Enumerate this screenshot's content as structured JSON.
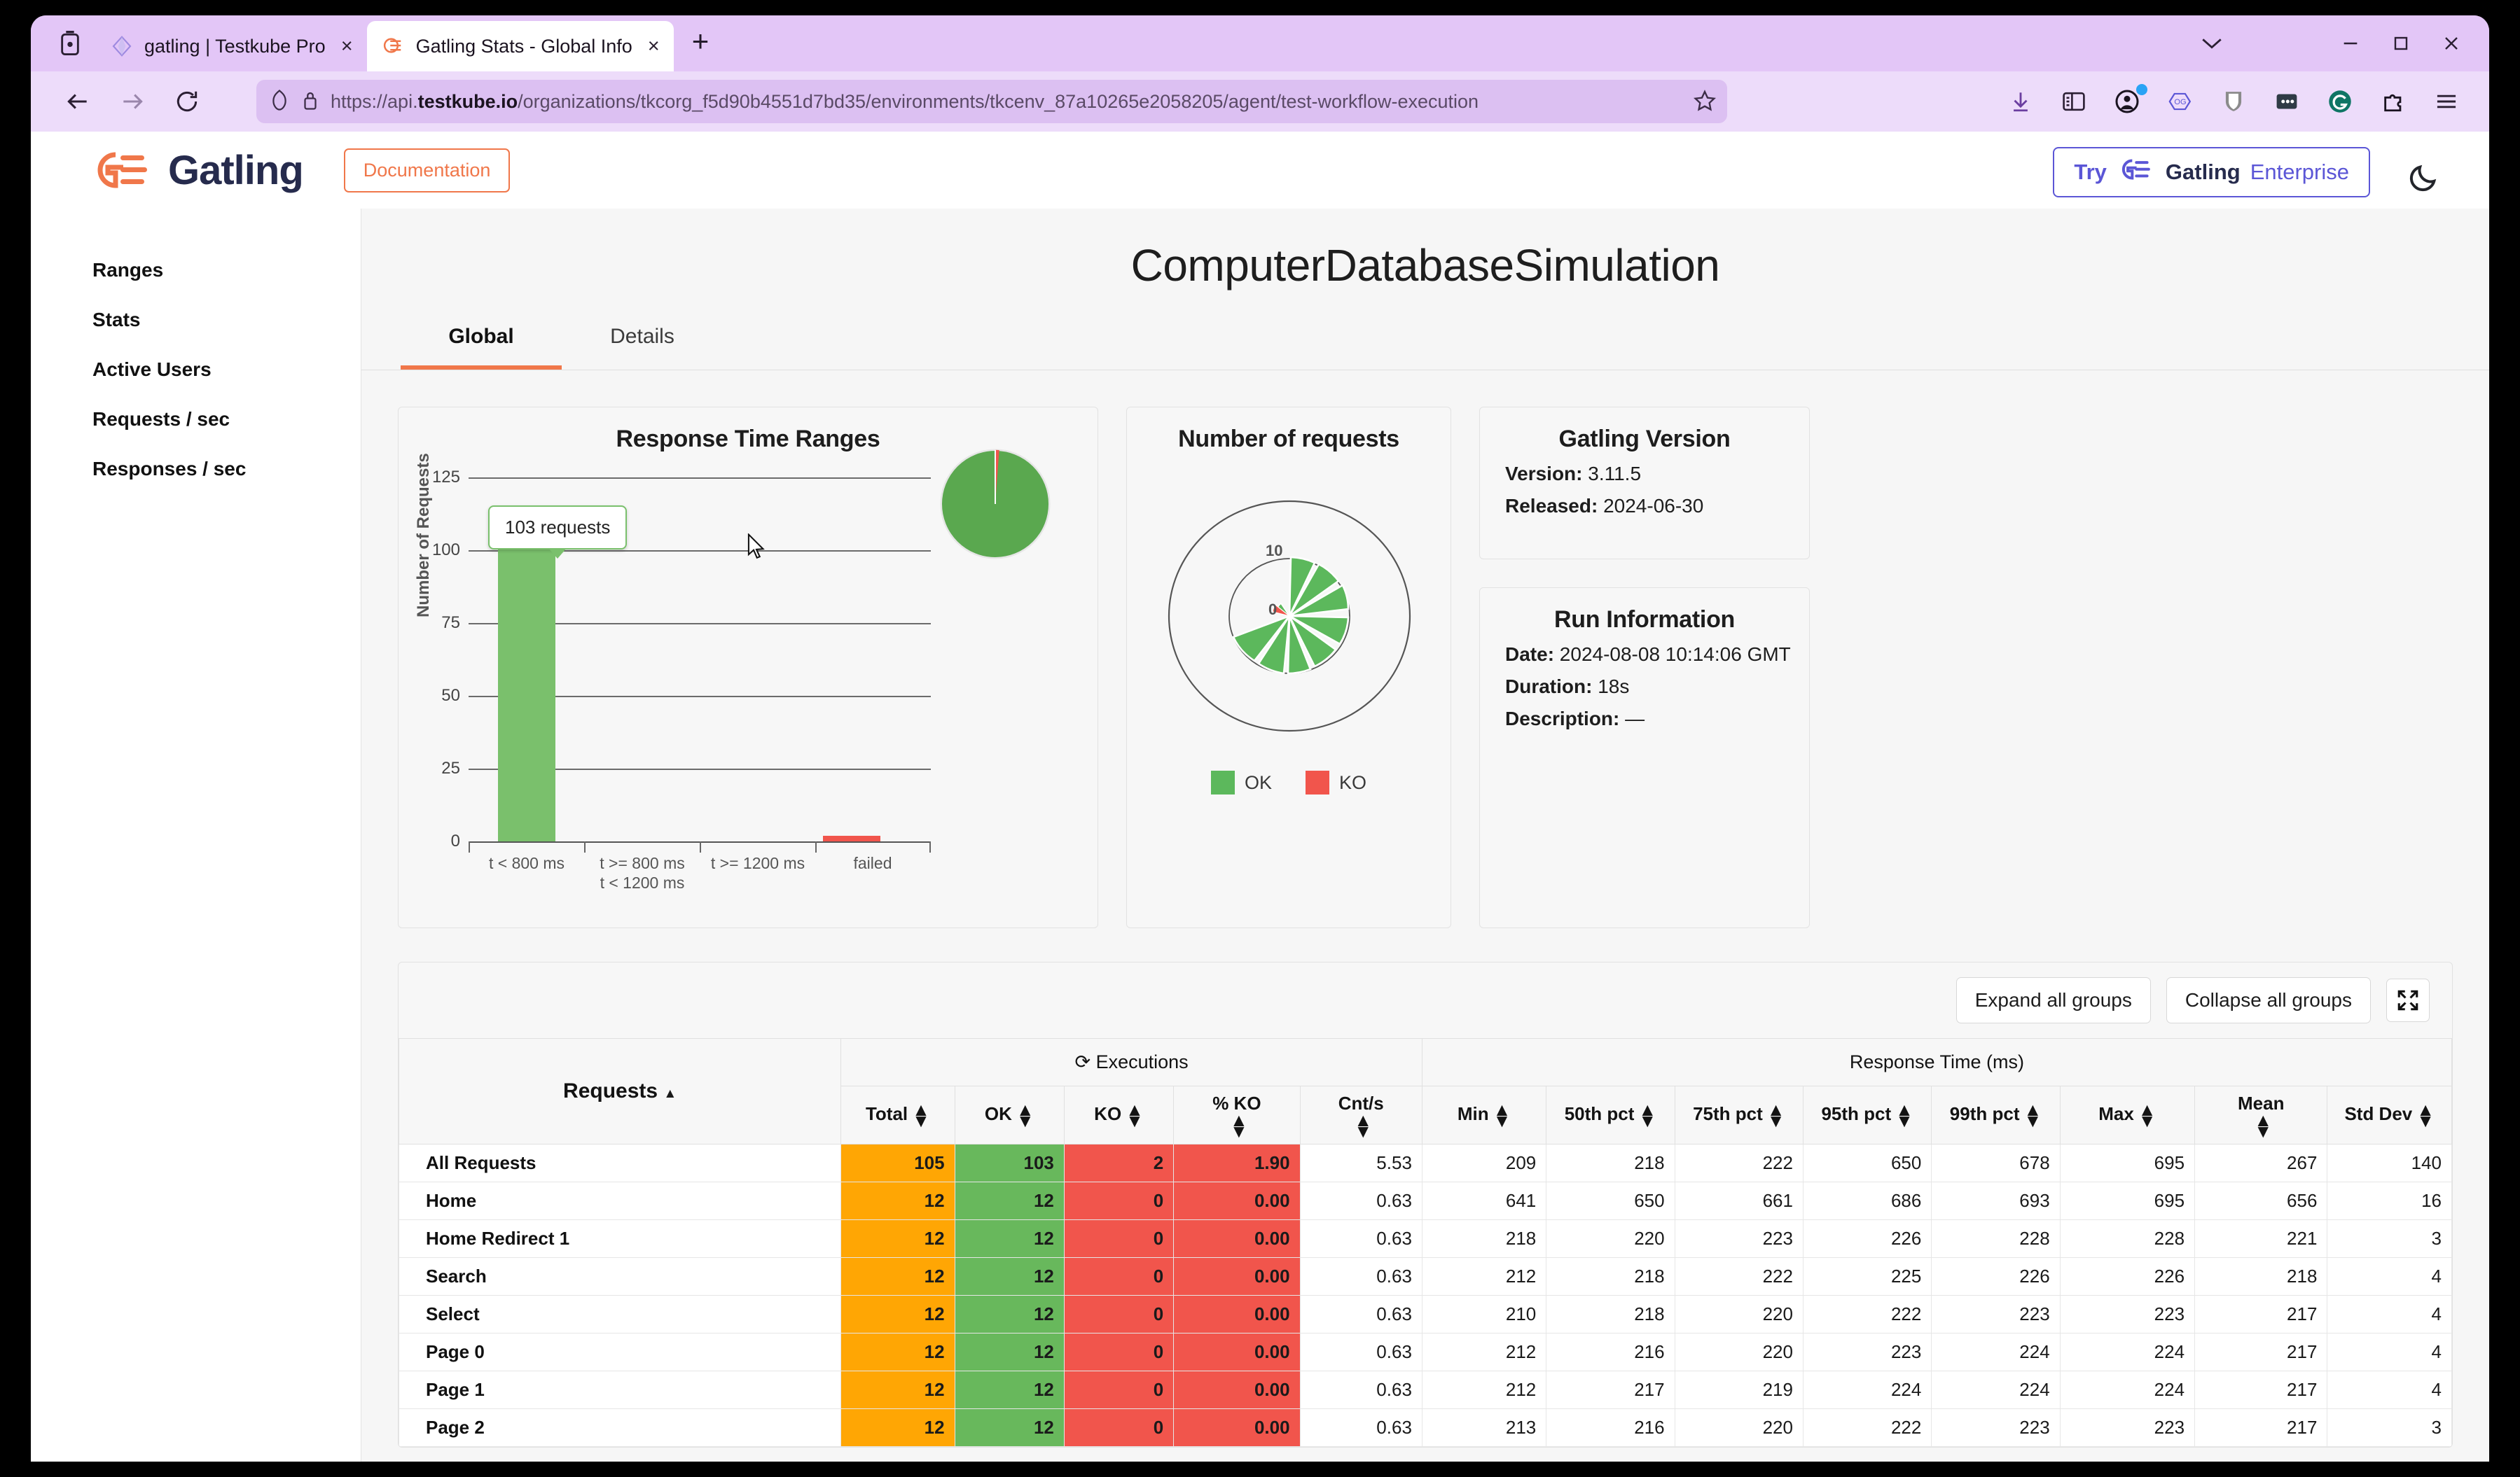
{
  "browser": {
    "tabs": [
      {
        "title": "gatling | Testkube Pro",
        "favicon": "testkube-diamond-icon",
        "active": false,
        "close_label": "×"
      },
      {
        "title": "Gatling Stats - Global Info",
        "favicon": "gatling-icon",
        "active": true,
        "close_label": "×"
      }
    ],
    "new_tab_label": "+",
    "url": "https://api.testkube.io/organizations/tkcorg_f5d90b4551d7bd35/environments/tkcenv_87a10265e2058205/agent/test-workflow-execution",
    "url_bold_part": "testkube.io",
    "window_controls": {
      "minimize": "—",
      "maximize": "□",
      "close": "✕",
      "list_tabs": "⌄"
    },
    "toolbar_icons": [
      "downloads-icon",
      "sidebar-icon",
      "account-icon",
      "origami-og-icon",
      "shield-icon",
      "dots-extension-icon",
      "grammarly-icon",
      "extensions-puzzle-icon",
      "app-menu-icon"
    ]
  },
  "gatling_header": {
    "wordmark": "Gatling",
    "documentation_label": "Documentation",
    "enterprise_try": "Try",
    "enterprise_gatling": "Gatling",
    "enterprise_suffix": "Enterprise",
    "dark_mode_icon": "moon-icon"
  },
  "sidebar": {
    "items": [
      {
        "label": "Ranges"
      },
      {
        "label": "Stats"
      },
      {
        "label": "Active Users"
      },
      {
        "label": "Requests / sec"
      },
      {
        "label": "Responses / sec"
      }
    ]
  },
  "main": {
    "title": "ComputerDatabaseSimulation",
    "tabs": [
      {
        "label": "Global",
        "active": true
      },
      {
        "label": "Details",
        "active": false
      }
    ]
  },
  "version_panel": {
    "title": "Gatling Version",
    "rows": [
      {
        "label": "Version:",
        "value": "3.11.5"
      },
      {
        "label": "Released:",
        "value": "2024-06-30"
      }
    ]
  },
  "run_panel": {
    "title": "Run Information",
    "rows": [
      {
        "label": "Date:",
        "value": "2024-08-08 10:14:06 GMT"
      },
      {
        "label": "Duration:",
        "value": "18s"
      },
      {
        "label": "Description:",
        "value": "—"
      }
    ]
  },
  "table_toolbar": {
    "expand_label": "Expand all groups",
    "collapse_label": "Collapse all groups",
    "fullscreen_icon": "expand-arrows-icon"
  },
  "stats_table": {
    "group_headers": [
      {
        "label": "Requests",
        "sort": "▲"
      },
      {
        "label": "Executions",
        "icon": "refresh-icon"
      },
      {
        "label": "Response Time (ms)"
      }
    ],
    "columns": [
      "Total",
      "OK",
      "KO",
      "% KO",
      "Cnt/s",
      "Min",
      "50th pct",
      "75th pct",
      "95th pct",
      "99th pct",
      "Max",
      "Mean",
      "Std Dev"
    ],
    "rows": [
      {
        "name": "All Requests",
        "total": "105",
        "ok": "103",
        "ko": "2",
        "pct_ko": "1.90",
        "cnt_s": "5.53",
        "min": "209",
        "p50": "218",
        "p75": "222",
        "p95": "650",
        "p99": "678",
        "max": "695",
        "mean": "267",
        "stddev": "140"
      },
      {
        "name": "Home",
        "total": "12",
        "ok": "12",
        "ko": "0",
        "pct_ko": "0.00",
        "cnt_s": "0.63",
        "min": "641",
        "p50": "650",
        "p75": "661",
        "p95": "686",
        "p99": "693",
        "max": "695",
        "mean": "656",
        "stddev": "16"
      },
      {
        "name": "Home Redirect 1",
        "total": "12",
        "ok": "12",
        "ko": "0",
        "pct_ko": "0.00",
        "cnt_s": "0.63",
        "min": "218",
        "p50": "220",
        "p75": "223",
        "p95": "226",
        "p99": "228",
        "max": "228",
        "mean": "221",
        "stddev": "3"
      },
      {
        "name": "Search",
        "total": "12",
        "ok": "12",
        "ko": "0",
        "pct_ko": "0.00",
        "cnt_s": "0.63",
        "min": "212",
        "p50": "218",
        "p75": "222",
        "p95": "225",
        "p99": "226",
        "max": "226",
        "mean": "218",
        "stddev": "4"
      },
      {
        "name": "Select",
        "total": "12",
        "ok": "12",
        "ko": "0",
        "pct_ko": "0.00",
        "cnt_s": "0.63",
        "min": "210",
        "p50": "218",
        "p75": "220",
        "p95": "222",
        "p99": "223",
        "max": "223",
        "mean": "217",
        "stddev": "4"
      },
      {
        "name": "Page 0",
        "total": "12",
        "ok": "12",
        "ko": "0",
        "pct_ko": "0.00",
        "cnt_s": "0.63",
        "min": "212",
        "p50": "216",
        "p75": "220",
        "p95": "223",
        "p99": "224",
        "max": "224",
        "mean": "217",
        "stddev": "4"
      },
      {
        "name": "Page 1",
        "total": "12",
        "ok": "12",
        "ko": "0",
        "pct_ko": "0.00",
        "cnt_s": "0.63",
        "min": "212",
        "p50": "217",
        "p75": "219",
        "p95": "224",
        "p99": "224",
        "max": "224",
        "mean": "217",
        "stddev": "4"
      },
      {
        "name": "Page 2",
        "total": "12",
        "ok": "12",
        "ko": "0",
        "pct_ko": "0.00",
        "cnt_s": "0.63",
        "min": "213",
        "p50": "216",
        "p75": "220",
        "p95": "222",
        "p99": "223",
        "max": "223",
        "mean": "217",
        "stddev": "3"
      }
    ]
  },
  "chart_data": [
    {
      "type": "bar",
      "title": "Response Time Ranges",
      "xlabel": "",
      "ylabel": "Number of Requests",
      "categories": [
        "t < 800 ms",
        "t >= 800 ms\nt < 1200 ms",
        "t >= 1200 ms",
        "failed"
      ],
      "category_lines": [
        [
          "t < 800 ms"
        ],
        [
          "t >= 800 ms",
          "t < 1200 ms"
        ],
        [
          "t >= 1200 ms"
        ],
        [
          "failed"
        ]
      ],
      "values": [
        103,
        0,
        0,
        2
      ],
      "colors": [
        "#7ac06c",
        "#f2b134",
        "#f1554c",
        "#f1554c"
      ],
      "ylim": [
        0,
        125
      ],
      "yticks": [
        0,
        25,
        50,
        75,
        100,
        125
      ],
      "grid": true,
      "tooltip": "103 requests",
      "pie": {
        "type": "pie",
        "labels": [
          "OK",
          "KO"
        ],
        "values": [
          103,
          2
        ],
        "colors": [
          "#5aa84f",
          "#f1554c"
        ]
      }
    },
    {
      "type": "polar",
      "title": "Number of requests",
      "radial_ticks": [
        0,
        10
      ],
      "legend": [
        {
          "label": "OK",
          "color": "#5cb85c"
        },
        {
          "label": "KO",
          "color": "#f1554c"
        }
      ],
      "series": [
        {
          "name": "OK",
          "values": [
            12,
            12,
            12,
            12,
            12,
            12,
            12,
            12,
            11
          ]
        },
        {
          "name": "KO",
          "values": [
            2
          ]
        }
      ]
    }
  ],
  "colors": {
    "accent_orange": "#f0774a",
    "gatling_navy": "#262b4d",
    "enterprise_purple": "#5b56d6",
    "ok_green": "#68b85c",
    "ko_red": "#f1554c",
    "total_orange": "#ffa604",
    "browser_chrome": "#e3c6f7"
  }
}
